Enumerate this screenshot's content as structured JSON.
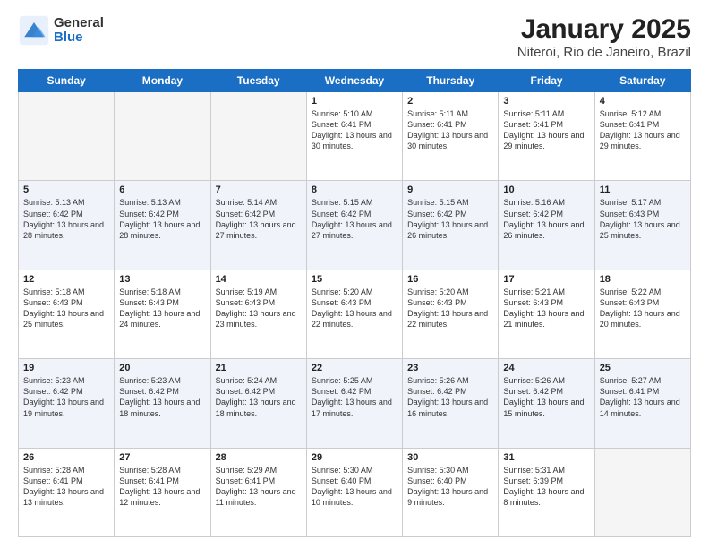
{
  "logo": {
    "general": "General",
    "blue": "Blue"
  },
  "title": "January 2025",
  "subtitle": "Niteroi, Rio de Janeiro, Brazil",
  "days": [
    "Sunday",
    "Monday",
    "Tuesday",
    "Wednesday",
    "Thursday",
    "Friday",
    "Saturday"
  ],
  "weeks": [
    [
      {
        "num": "",
        "sunrise": "",
        "sunset": "",
        "daylight": ""
      },
      {
        "num": "",
        "sunrise": "",
        "sunset": "",
        "daylight": ""
      },
      {
        "num": "",
        "sunrise": "",
        "sunset": "",
        "daylight": ""
      },
      {
        "num": "1",
        "sunrise": "5:10 AM",
        "sunset": "6:41 PM",
        "daylight": "13 hours and 30 minutes."
      },
      {
        "num": "2",
        "sunrise": "5:11 AM",
        "sunset": "6:41 PM",
        "daylight": "13 hours and 30 minutes."
      },
      {
        "num": "3",
        "sunrise": "5:11 AM",
        "sunset": "6:41 PM",
        "daylight": "13 hours and 29 minutes."
      },
      {
        "num": "4",
        "sunrise": "5:12 AM",
        "sunset": "6:41 PM",
        "daylight": "13 hours and 29 minutes."
      }
    ],
    [
      {
        "num": "5",
        "sunrise": "5:13 AM",
        "sunset": "6:42 PM",
        "daylight": "13 hours and 28 minutes."
      },
      {
        "num": "6",
        "sunrise": "5:13 AM",
        "sunset": "6:42 PM",
        "daylight": "13 hours and 28 minutes."
      },
      {
        "num": "7",
        "sunrise": "5:14 AM",
        "sunset": "6:42 PM",
        "daylight": "13 hours and 27 minutes."
      },
      {
        "num": "8",
        "sunrise": "5:15 AM",
        "sunset": "6:42 PM",
        "daylight": "13 hours and 27 minutes."
      },
      {
        "num": "9",
        "sunrise": "5:15 AM",
        "sunset": "6:42 PM",
        "daylight": "13 hours and 26 minutes."
      },
      {
        "num": "10",
        "sunrise": "5:16 AM",
        "sunset": "6:42 PM",
        "daylight": "13 hours and 26 minutes."
      },
      {
        "num": "11",
        "sunrise": "5:17 AM",
        "sunset": "6:43 PM",
        "daylight": "13 hours and 25 minutes."
      }
    ],
    [
      {
        "num": "12",
        "sunrise": "5:18 AM",
        "sunset": "6:43 PM",
        "daylight": "13 hours and 25 minutes."
      },
      {
        "num": "13",
        "sunrise": "5:18 AM",
        "sunset": "6:43 PM",
        "daylight": "13 hours and 24 minutes."
      },
      {
        "num": "14",
        "sunrise": "5:19 AM",
        "sunset": "6:43 PM",
        "daylight": "13 hours and 23 minutes."
      },
      {
        "num": "15",
        "sunrise": "5:20 AM",
        "sunset": "6:43 PM",
        "daylight": "13 hours and 22 minutes."
      },
      {
        "num": "16",
        "sunrise": "5:20 AM",
        "sunset": "6:43 PM",
        "daylight": "13 hours and 22 minutes."
      },
      {
        "num": "17",
        "sunrise": "5:21 AM",
        "sunset": "6:43 PM",
        "daylight": "13 hours and 21 minutes."
      },
      {
        "num": "18",
        "sunrise": "5:22 AM",
        "sunset": "6:43 PM",
        "daylight": "13 hours and 20 minutes."
      }
    ],
    [
      {
        "num": "19",
        "sunrise": "5:23 AM",
        "sunset": "6:42 PM",
        "daylight": "13 hours and 19 minutes."
      },
      {
        "num": "20",
        "sunrise": "5:23 AM",
        "sunset": "6:42 PM",
        "daylight": "13 hours and 18 minutes."
      },
      {
        "num": "21",
        "sunrise": "5:24 AM",
        "sunset": "6:42 PM",
        "daylight": "13 hours and 18 minutes."
      },
      {
        "num": "22",
        "sunrise": "5:25 AM",
        "sunset": "6:42 PM",
        "daylight": "13 hours and 17 minutes."
      },
      {
        "num": "23",
        "sunrise": "5:26 AM",
        "sunset": "6:42 PM",
        "daylight": "13 hours and 16 minutes."
      },
      {
        "num": "24",
        "sunrise": "5:26 AM",
        "sunset": "6:42 PM",
        "daylight": "13 hours and 15 minutes."
      },
      {
        "num": "25",
        "sunrise": "5:27 AM",
        "sunset": "6:41 PM",
        "daylight": "13 hours and 14 minutes."
      }
    ],
    [
      {
        "num": "26",
        "sunrise": "5:28 AM",
        "sunset": "6:41 PM",
        "daylight": "13 hours and 13 minutes."
      },
      {
        "num": "27",
        "sunrise": "5:28 AM",
        "sunset": "6:41 PM",
        "daylight": "13 hours and 12 minutes."
      },
      {
        "num": "28",
        "sunrise": "5:29 AM",
        "sunset": "6:41 PM",
        "daylight": "13 hours and 11 minutes."
      },
      {
        "num": "29",
        "sunrise": "5:30 AM",
        "sunset": "6:40 PM",
        "daylight": "13 hours and 10 minutes."
      },
      {
        "num": "30",
        "sunrise": "5:30 AM",
        "sunset": "6:40 PM",
        "daylight": "13 hours and 9 minutes."
      },
      {
        "num": "31",
        "sunrise": "5:31 AM",
        "sunset": "6:39 PM",
        "daylight": "13 hours and 8 minutes."
      },
      {
        "num": "",
        "sunrise": "",
        "sunset": "",
        "daylight": ""
      }
    ]
  ],
  "labels": {
    "sunrise": "Sunrise:",
    "sunset": "Sunset:",
    "daylight": "Daylight:"
  }
}
